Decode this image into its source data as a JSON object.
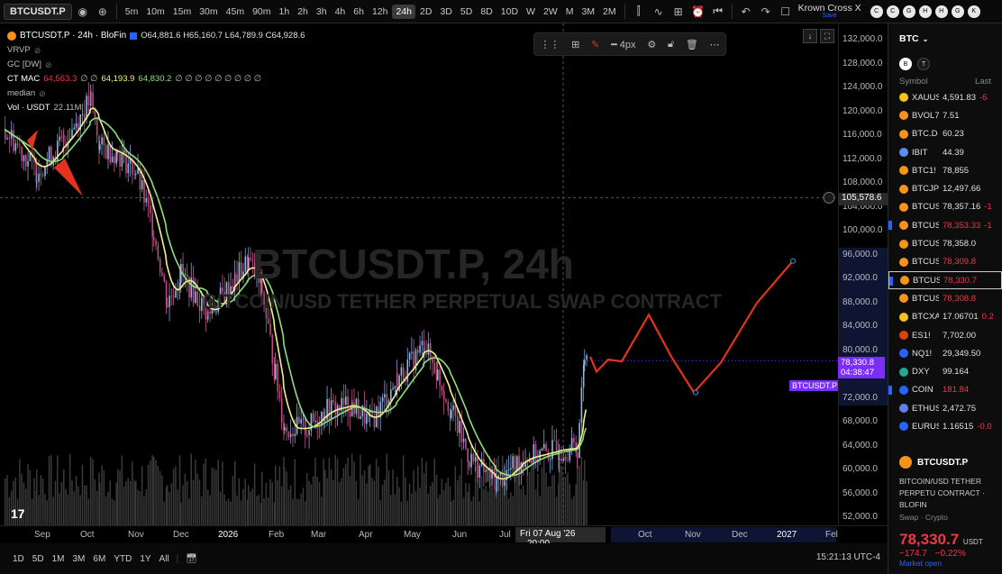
{
  "toolbar": {
    "symbol": "BTCUSDT.P",
    "timeframes": [
      "5m",
      "10m",
      "15m",
      "30m",
      "45m",
      "90m",
      "1h",
      "2h",
      "3h",
      "4h",
      "6h",
      "12h",
      "24h",
      "2D",
      "3D",
      "5D",
      "8D",
      "10D",
      "W",
      "2W",
      "M",
      "3M",
      "2M"
    ],
    "active_timeframe": "24h",
    "layout_name": "Krown Cross X",
    "layout_status": "Save",
    "quick_circles": [
      "C",
      "C",
      "G",
      "H",
      "H",
      "G",
      "K"
    ]
  },
  "legend": {
    "title": "BTCUSDT.P · 24h · BloFin",
    "ohlc": "O64,881.6 H65,160.7 L64,789.9 C64,928.6",
    "ind1": "VRVP",
    "ind2": "GC [DW]",
    "ind3_name": "CT MAC",
    "ind3_v1": "64,563.3",
    "ind3_v2": "∅ ∅",
    "ind3_v3": "64,193.9",
    "ind3_v4": "64,830.2",
    "ind3_rest": "∅ ∅ ∅ ∅ ∅ ∅ ∅ ∅ ∅",
    "ind4": "median",
    "ind5_name": "Vol · USDT",
    "ind5_val": "22.11M"
  },
  "watermark": {
    "symbol": "BTCUSDT.P, 24h",
    "desc": "BITCOIN/USD TETHER PERPETUAL SWAP CONTRACT"
  },
  "draw_toolbar": {
    "width_label": "4px"
  },
  "price_axis": {
    "labels": [
      "132,000.0",
      "128,000.0",
      "124,000.0",
      "120,000.0",
      "116,000.0",
      "112,000.0",
      "108,000.0",
      "104,000.0",
      "100,000.0",
      "96,000.0",
      "92,000.0",
      "88,000.0",
      "84,000.0",
      "80,000.0",
      "76,000.0",
      "72,000.0",
      "68,000.0",
      "64,000.0",
      "60,000.0",
      "56,000.0",
      "52,000.0"
    ],
    "crosshair_price": "105,578.6",
    "current_price": "78,330.8",
    "countdown": "04:38:47",
    "symbol_tag": "BTCUSDT.P"
  },
  "time_axis": {
    "labels": [
      "Sep",
      "Oct",
      "Nov",
      "Dec",
      "2026",
      "Feb",
      "Mar",
      "Apr",
      "May",
      "Jun",
      "Jul",
      "Oct",
      "Nov",
      "Dec",
      "2027",
      "Fel"
    ],
    "crosshair_date": "Fri 07 Aug '26",
    "crosshair_time": "20:00"
  },
  "bottom": {
    "ranges": [
      "1D",
      "5D",
      "1M",
      "3M",
      "6M",
      "YTD",
      "1Y",
      "All"
    ],
    "clock": "15:21:13 UTC-4"
  },
  "watchlist": {
    "name": "BTC",
    "tabs": [
      "B",
      "T"
    ],
    "col_symbol": "Symbol",
    "col_last": "Last",
    "rows": [
      {
        "sym": "XAUUS",
        "last": "4,591.83",
        "extra": "-6",
        "color": "#f7c21a",
        "red": false
      },
      {
        "sym": "BVOL7",
        "last": "7.51",
        "extra": "",
        "color": "#f7931a",
        "red": false
      },
      {
        "sym": "BTC.D",
        "last": "60.23",
        "extra": "",
        "color": "#f7931a",
        "red": false
      },
      {
        "sym": "IBIT",
        "last": "44.39",
        "extra": "",
        "color": "#5b8def",
        "red": false
      },
      {
        "sym": "BTC1!",
        "last": "78,855",
        "extra": "",
        "color": "#f7931a",
        "red": false
      },
      {
        "sym": "BTCJP",
        "last": "12,497.66",
        "extra": "",
        "color": "#f7931a",
        "red": false
      },
      {
        "sym": "BTCUS",
        "last": "78,357.16",
        "extra": "-1",
        "color": "#f7931a",
        "red": false
      },
      {
        "sym": "BTCUS",
        "last": "78,353.33",
        "extra": "-1",
        "color": "#f7931a",
        "red": true
      },
      {
        "sym": "BTCUS",
        "last": "78,358.0",
        "extra": "",
        "color": "#f7931a",
        "red": false
      },
      {
        "sym": "BTCUS",
        "last": "78,309.8",
        "extra": "",
        "color": "#f7931a",
        "red": true
      },
      {
        "sym": "BTCUS",
        "last": "78,330.7",
        "extra": "",
        "color": "#f7931a",
        "red": true
      },
      {
        "sym": "BTCUS",
        "last": "78,308.8",
        "extra": "",
        "color": "#f7931a",
        "red": true
      },
      {
        "sym": "BTCXA",
        "last": "17.06701",
        "extra": "0.2",
        "color": "#f7c21a",
        "red": false
      },
      {
        "sym": "ES1!",
        "last": "7,702.00",
        "extra": "",
        "color": "#d84315",
        "red": false
      },
      {
        "sym": "NQ1!",
        "last": "29,349.50",
        "extra": "",
        "color": "#2962ff",
        "red": false
      },
      {
        "sym": "DXY",
        "last": "99.164",
        "extra": "",
        "color": "#26a69a",
        "red": false
      },
      {
        "sym": "COIN",
        "last": "181.84",
        "extra": "",
        "color": "#2962ff",
        "red": true
      },
      {
        "sym": "ETHUS",
        "last": "2,472.75",
        "extra": "",
        "color": "#627eea",
        "red": false
      },
      {
        "sym": "EURUS",
        "last": "1.16515",
        "extra": "-0.0",
        "color": "#2962ff",
        "red": false
      }
    ],
    "detail": {
      "symbol": "BTCUSDT.P",
      "desc": "BITCOIN/USD TETHER PERPETU CONTRACT",
      "exchange": "· BLOFIN",
      "type": "Swap · Crypto",
      "price": "78,330.7",
      "currency": "USDT",
      "change": "−174.7",
      "change_pct": "−0.22%",
      "status": "Market open"
    }
  },
  "colors": {
    "accent": "#7b2cff",
    "down": "#f23645",
    "up": "#26a69a",
    "projection": "#e5321f",
    "ma_yellow": "#f5f08a",
    "ma_green": "#8fe07a"
  }
}
